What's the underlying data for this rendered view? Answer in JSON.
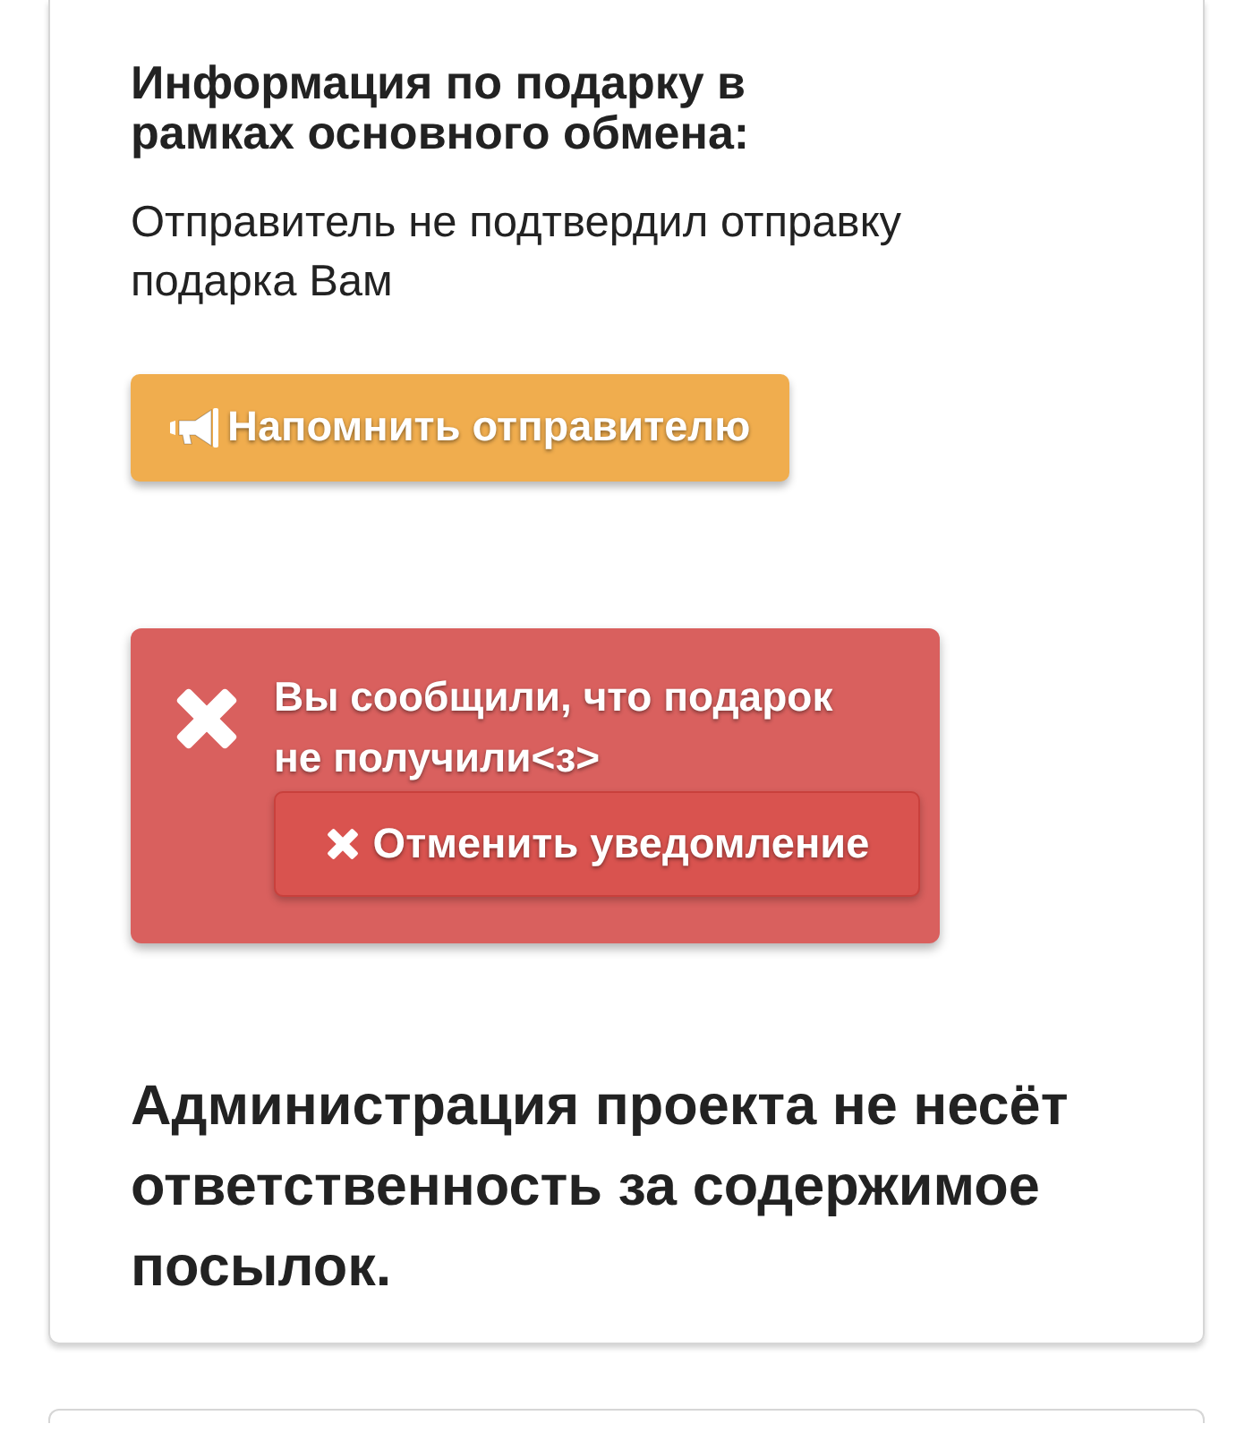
{
  "info": {
    "title": "Информация по подарку в рамках основного обмена:",
    "status": "Отправитель не подтвердил отправку подарка Вам"
  },
  "remind_button": {
    "label": "Напомнить отправителю"
  },
  "alert": {
    "kind": "danger",
    "message": "Вы сообщили, что подарок не получили<з>",
    "cancel_button": {
      "label": "Отменить уведомление"
    }
  },
  "disclaimer": "Администрация проекта не несёт ответственность за содержимое посылок."
}
